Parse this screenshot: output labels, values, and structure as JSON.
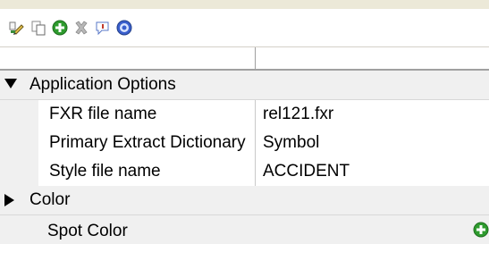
{
  "toolbar": {
    "buttons": [
      {
        "icon": "edit-pencil-icon"
      },
      {
        "icon": "copy-icon"
      },
      {
        "icon": "add-icon"
      },
      {
        "icon": "delete-icon"
      },
      {
        "icon": "info-icon"
      },
      {
        "icon": "help-icon"
      }
    ]
  },
  "grid": {
    "category_application": "Application Options",
    "rows": [
      {
        "name": "FXR file name",
        "value": "rel121.fxr"
      },
      {
        "name": "Primary Extract Dictionary",
        "value": "Symbol"
      },
      {
        "name": "Style file name",
        "value": "ACCIDENT"
      }
    ],
    "category_color": "Color",
    "spot_color_label": "Spot Color"
  },
  "colors": {
    "category_bg": "#f0f0f0",
    "add_green": "#2e9b2e",
    "help_blue": "#3a5fcd"
  }
}
